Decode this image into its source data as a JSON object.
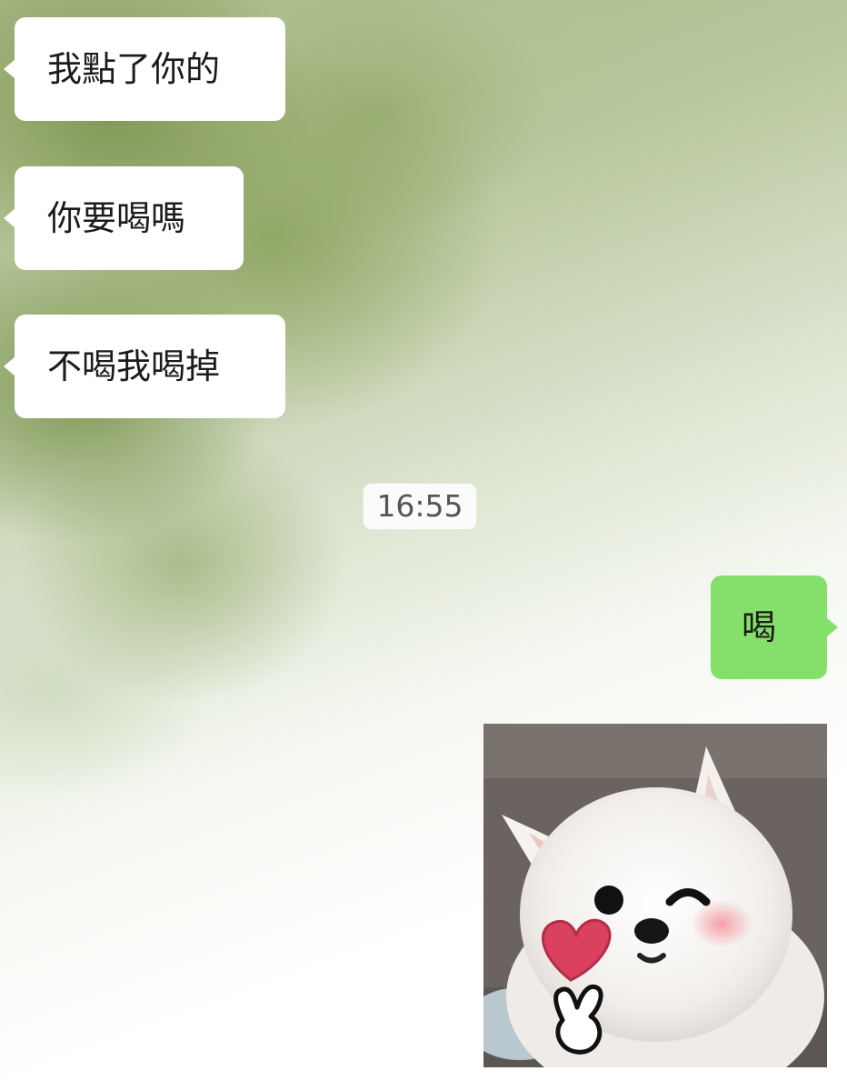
{
  "chat": {
    "incoming_messages": [
      {
        "text": "我點了你的"
      },
      {
        "text": "你要喝嗎"
      },
      {
        "text": "不喝我喝掉"
      }
    ],
    "timestamp": "16:55",
    "outgoing_messages": [
      {
        "text": "喝"
      }
    ],
    "sticker": {
      "icon": "dog-sticker-icon"
    }
  },
  "colors": {
    "incoming_bubble": "#ffffff",
    "outgoing_bubble": "#84e06a",
    "background_green": "#8ea260"
  }
}
